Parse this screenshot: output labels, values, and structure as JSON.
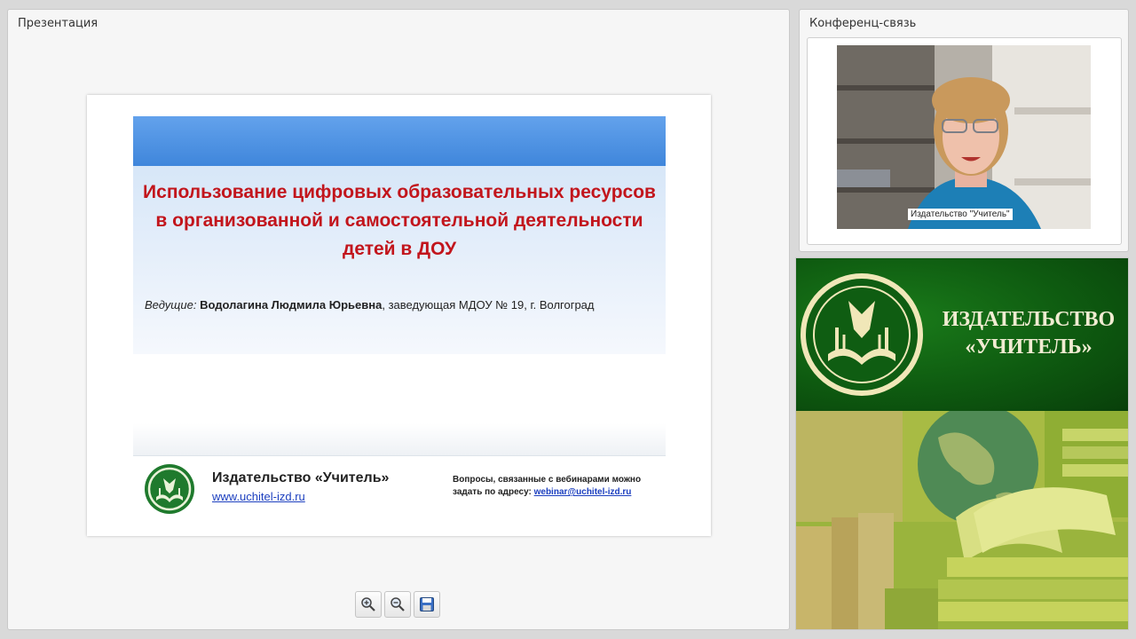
{
  "presentation": {
    "panel_title": "Презентация",
    "slide": {
      "title": "Использование цифровых образовательных ресурсов в организованной и самостоятельной деятельности детей в ДОУ",
      "presenter_label": "Ведущие:",
      "presenter_name": "Водолагина Людмила Юрьевна",
      "presenter_role": ", заведующая МДОУ № 19, г. Волгоград",
      "publisher": "Издательство «Учитель»",
      "website": "www.uchitel-izd.ru",
      "questions_text": "Вопросы, связанные с вебинарами можно задать по адресу:",
      "email": "webinar@uchitel-izd.ru"
    },
    "toolbar": {
      "zoom_in_icon": "zoom-in-icon",
      "zoom_out_icon": "zoom-out-icon",
      "save_icon": "save-icon"
    }
  },
  "conference": {
    "panel_title": "Конференц-связь",
    "video_caption": "Издательство \"Учитель\""
  },
  "banner": {
    "line1": "ИЗДАТЕЛЬСТВО",
    "line2": "«УЧИТЕЛЬ»"
  },
  "colors": {
    "title_red": "#c2151c",
    "slide_blue": "#3f86db",
    "banner_green": "#0e5a10",
    "link_blue": "#1c3fbf"
  }
}
